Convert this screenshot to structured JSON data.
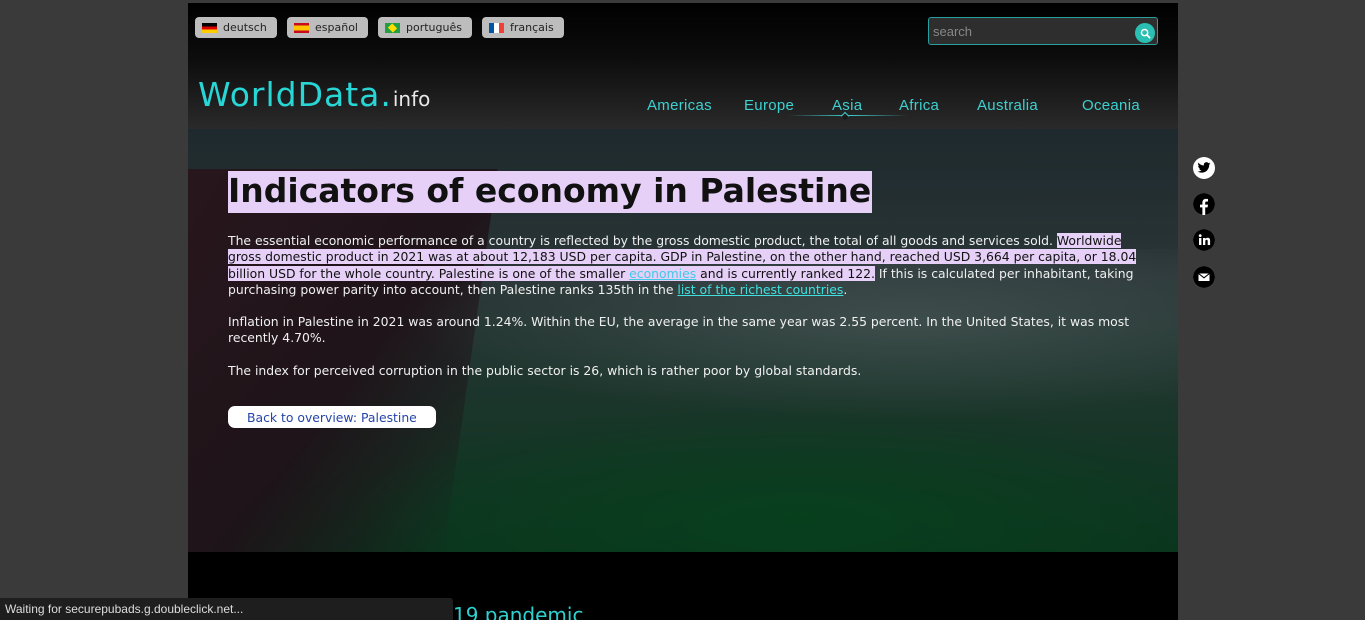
{
  "languages": [
    {
      "label": "deutsch",
      "flag": "germany-flag-icon"
    },
    {
      "label": "español",
      "flag": "spain-flag-icon"
    },
    {
      "label": "português",
      "flag": "brazil-flag-icon"
    },
    {
      "label": "français",
      "flag": "france-flag-icon"
    }
  ],
  "search": {
    "placeholder": "search",
    "value": ""
  },
  "logo": {
    "main": "WorldData.",
    "tld": "info"
  },
  "nav": [
    "Americas",
    "Europe",
    "Asia",
    "Africa",
    "Australia",
    "Oceania"
  ],
  "nav_active": "Asia",
  "main": {
    "title": "Indicators of economy in Palestine",
    "p1_a": "The essential economic performance of a country is reflected by the gross domestic product, the total of all goods and services sold. ",
    "p1_hl1": "Worldwide gross domestic product in 2021 was at about 12,183 USD per capita. GDP in Palestine, on the other hand, reached USD 3,664 per capita, or 18.04 billion USD for the whole country. Palestine is one of the smaller ",
    "p1_link1": "economies",
    "p1_hl2": " and is currently ranked 122.",
    "p1_b": " If this is calculated per inhabitant, taking purchasing power parity into account, then Palestine ranks 135th in the ",
    "p1_link2": "list of the richest countries",
    "p1_end": ".",
    "p2": "Inflation in Palestine in 2021 was around 1.24%. Within the EU, the average in the same year was 2.55 percent. In the United States, it was most recently 4.70%.",
    "p3": "The index for perceived corruption in the public sector is 26, which is rather poor by global standards.",
    "back_button": "Back to overview: Palestine",
    "next_heading_fragment": "19 pandemic"
  },
  "social": [
    "twitter-icon",
    "facebook-icon",
    "linkedin-icon",
    "email-icon"
  ],
  "status_bar": "Waiting for securepubads.g.doubleclick.net...",
  "colors": {
    "accent": "#3fd0d0",
    "highlight": "#e6d0f7",
    "background": "#000000"
  }
}
